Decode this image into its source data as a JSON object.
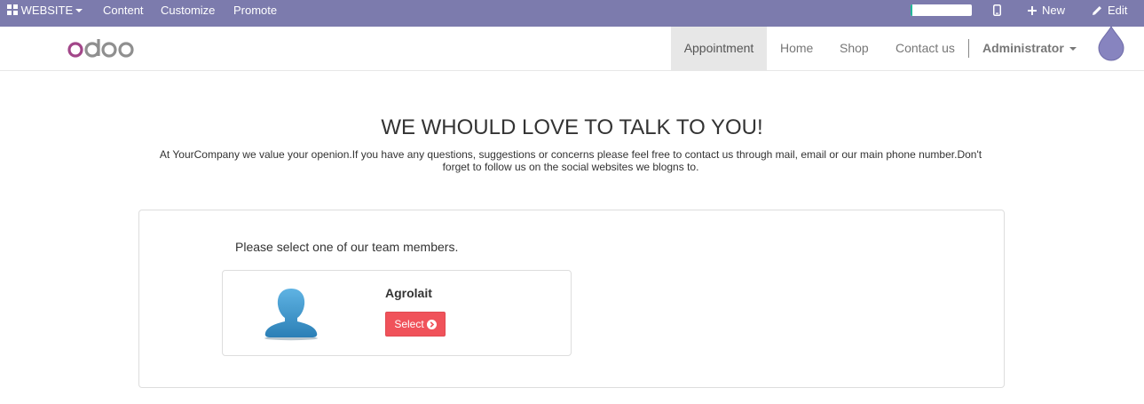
{
  "admin_bar": {
    "website_label": "WEBSITE",
    "content_label": "Content",
    "customize_label": "Customize",
    "promote_label": "Promote",
    "new_label": "New",
    "edit_label": "Edit",
    "progress_fraction": 0.03,
    "bar_color": "#7c7bad",
    "progress_color": "#21b799",
    "icons": [
      "grid-icon",
      "mobile-icon",
      "plus-icon",
      "pencil-icon"
    ]
  },
  "navbar": {
    "items": [
      {
        "label": "Appointment",
        "active": true
      },
      {
        "label": "Home"
      },
      {
        "label": "Shop"
      },
      {
        "label": "Contact us"
      }
    ],
    "user_label": "Administrator",
    "logo_icon": "odoo-logo",
    "badge_icon": "droplet-icon"
  },
  "content": {
    "heading": "WE WHOULD LOVE TO TALK TO YOU!",
    "intro": "At YourCompany we value your openion.If you have any questions, suggestions or concerns please feel free to contact us through mail, email or our main phone number.Don't forget to follow us on the social websites we blogns to.",
    "select_prompt": "Please select one of our team members.",
    "member": {
      "name": "Agrolait",
      "button_label": "Select",
      "button_icon": "chevron-circle-right-icon",
      "avatar_icon": "person-silhouette-icon",
      "button_color": "#f0525a"
    }
  }
}
